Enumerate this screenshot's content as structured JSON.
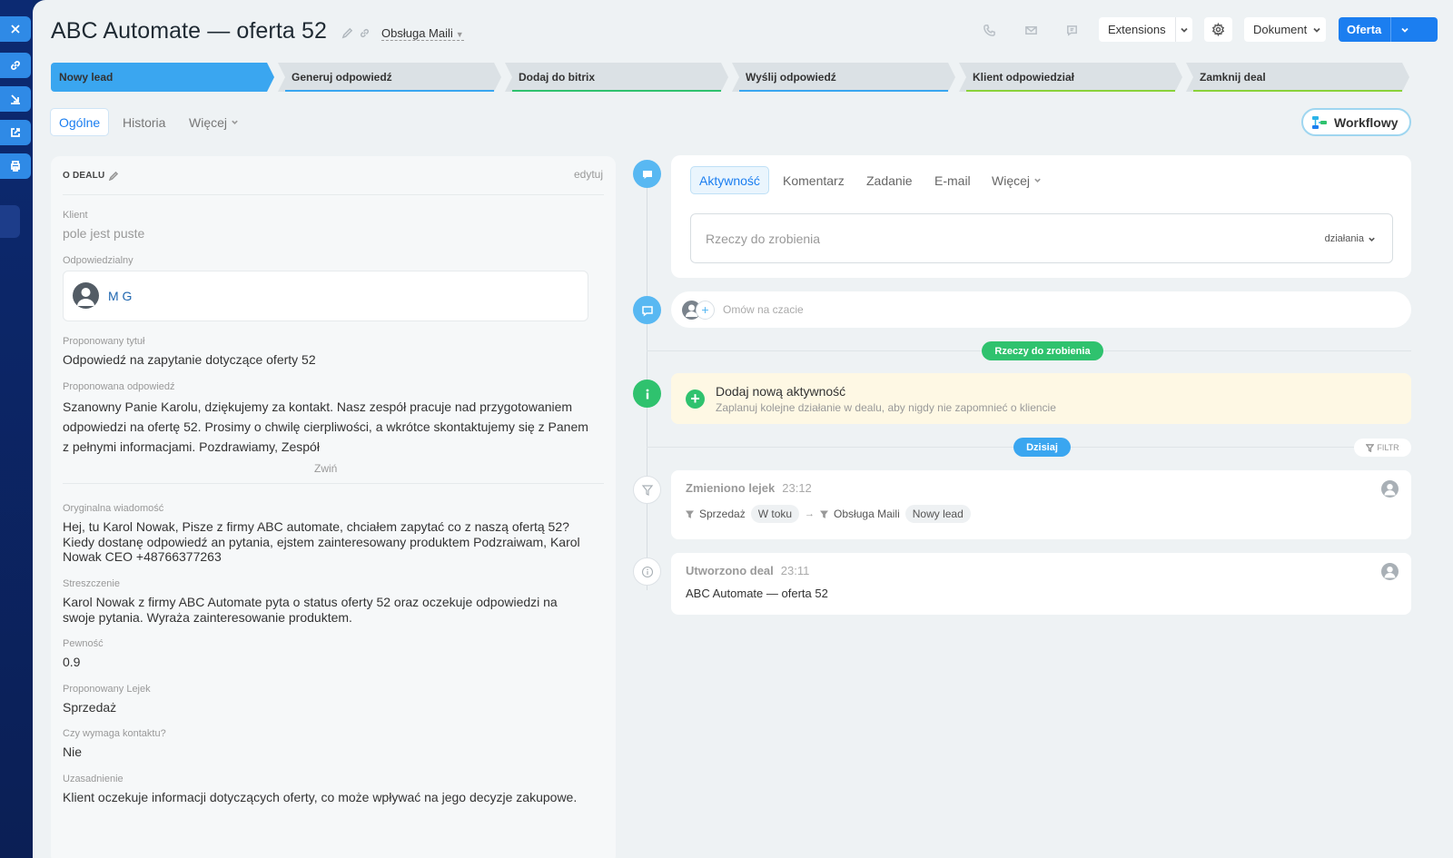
{
  "rail": {
    "icons": [
      "close-icon",
      "link-icon",
      "download-icon",
      "external-link-icon",
      "print-icon"
    ]
  },
  "header": {
    "title": "ABC Automate — oferta 52",
    "pipeline": "Obsługa Maili",
    "extensions_label": "Extensions",
    "document_label": "Dokument",
    "offer_label": "Oferta"
  },
  "stages": [
    {
      "label": "Nowy lead",
      "bar": "#3aa6f0"
    },
    {
      "label": "Generuj odpowiedź",
      "bar": "#39a6f0"
    },
    {
      "label": "Dodaj do bitrix",
      "bar": "#2fc26e"
    },
    {
      "label": "Wyślij odpowiedź",
      "bar": "#39a6f0"
    },
    {
      "label": "Klient odpowiedział",
      "bar": "#8ad23a"
    },
    {
      "label": "Zamknij deal",
      "bar": "#8ad23a"
    }
  ],
  "tabs": {
    "general": "Ogólne",
    "history": "Historia",
    "more": "Więcej",
    "workflow": "Workflowy"
  },
  "deal": {
    "section_title": "O DEALU",
    "edit_label": "edytuj",
    "client_label": "Klient",
    "client_value": "pole jest puste",
    "responsible_label": "Odpowiedzialny",
    "responsible_name": "M G",
    "title_label": "Proponowany tytuł",
    "title_value": "Odpowiedź na zapytanie dotyczące oferty 52",
    "response_label": "Proponowana odpowiedź",
    "response_value": "Szanowny Panie Karolu, dziękujemy za kontakt. Nasz zespół pracuje nad przygotowaniem odpowiedzi na ofertę 52. Prosimy o chwilę cierpliwości, a wkrótce skontaktujemy się z Panem z pełnymi informacjami. Pozdrawiamy, Zespół",
    "collapse_label": "Zwiń",
    "original_label": "Oryginalna wiadomość",
    "original_value": "Hej, tu Karol Nowak, Pisze z firmy ABC automate, chciałem zapytać co z naszą ofertą 52? Kiedy dostanę odpowiedź an pytania, ejstem zainteresowany produktem Podzraiwam, Karol Nowak CEO +48766377263",
    "summary_label": "Streszczenie",
    "summary_value": "Karol Nowak z firmy ABC Automate pyta o status oferty 52 oraz oczekuje odpowiedzi na swoje pytania. Wyraża zainteresowanie produktem.",
    "confidence_label": "Pewność",
    "confidence_value": "0.9",
    "funnel_label": "Proponowany Lejek",
    "funnel_value": "Sprzedaż",
    "contact_label": "Czy wymaga kontaktu?",
    "contact_value": "Nie",
    "reason_label": "Uzasadnienie",
    "reason_value": "Klient oczekuje informacji dotyczących oferty, co może wpływać na jego decyzje zakupowe."
  },
  "activity": {
    "tabs": [
      "Aktywność",
      "Komentarz",
      "Zadanie",
      "E-mail",
      "Więcej"
    ],
    "todo_placeholder": "Rzeczy do zrobienia",
    "actions_label": "działania",
    "chat_placeholder": "Omów na czacie",
    "todo_pill": "Rzeczy do zrobienia",
    "add_title": "Dodaj nową aktywność",
    "add_subtitle": "Zaplanuj kolejne działanie w dealu, aby nigdy nie zapomnieć o kliencie",
    "today_pill": "Dzisiaj",
    "filter_label": "FILTR"
  },
  "events": [
    {
      "title": "Zmieniono lejek",
      "time": "23:12",
      "from_funnel": "Sprzedaż",
      "from_stage": "W toku",
      "to_funnel": "Obsługa Maili",
      "to_stage": "Nowy lead"
    },
    {
      "title": "Utworzono deal",
      "time": "23:11",
      "text": "ABC Automate — oferta 52"
    }
  ],
  "colors": {
    "accent": "#1b7ef0",
    "green": "#2fc26e",
    "stage_active": "#3aa6f0"
  }
}
